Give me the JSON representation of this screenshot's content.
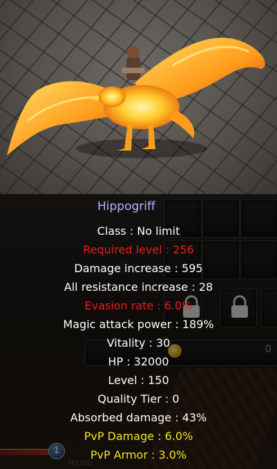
{
  "item": {
    "name": "Hippogriff",
    "lines": [
      {
        "text": "Class : No limit"
      },
      {
        "text": "Required level : 256"
      },
      {
        "text": "Damage increase : 595"
      },
      {
        "text": "All resistance increase : 28"
      },
      {
        "text": "Evasion rate : 6.0%"
      },
      {
        "text": "Magic attack power : 189%"
      },
      {
        "text": "Vitality : 30"
      },
      {
        "text": "HP : 32000"
      },
      {
        "text": "Level : 150"
      },
      {
        "text": "Quality Tier : 0"
      },
      {
        "text": "Absorbed damage : 43%"
      },
      {
        "text": "PvP Damage : 6.0%"
      },
      {
        "text": "PvP Armor : 3.0%"
      }
    ]
  },
  "inventory": {
    "gold_value": "0",
    "hotbar_slot": "1",
    "menu_label": "MENU"
  },
  "colors": {
    "title": "#b7b3ff",
    "normal": "#ffffff",
    "requirement_unmet": "#e81c1c",
    "pvp_bonus": "#f4e61f"
  }
}
